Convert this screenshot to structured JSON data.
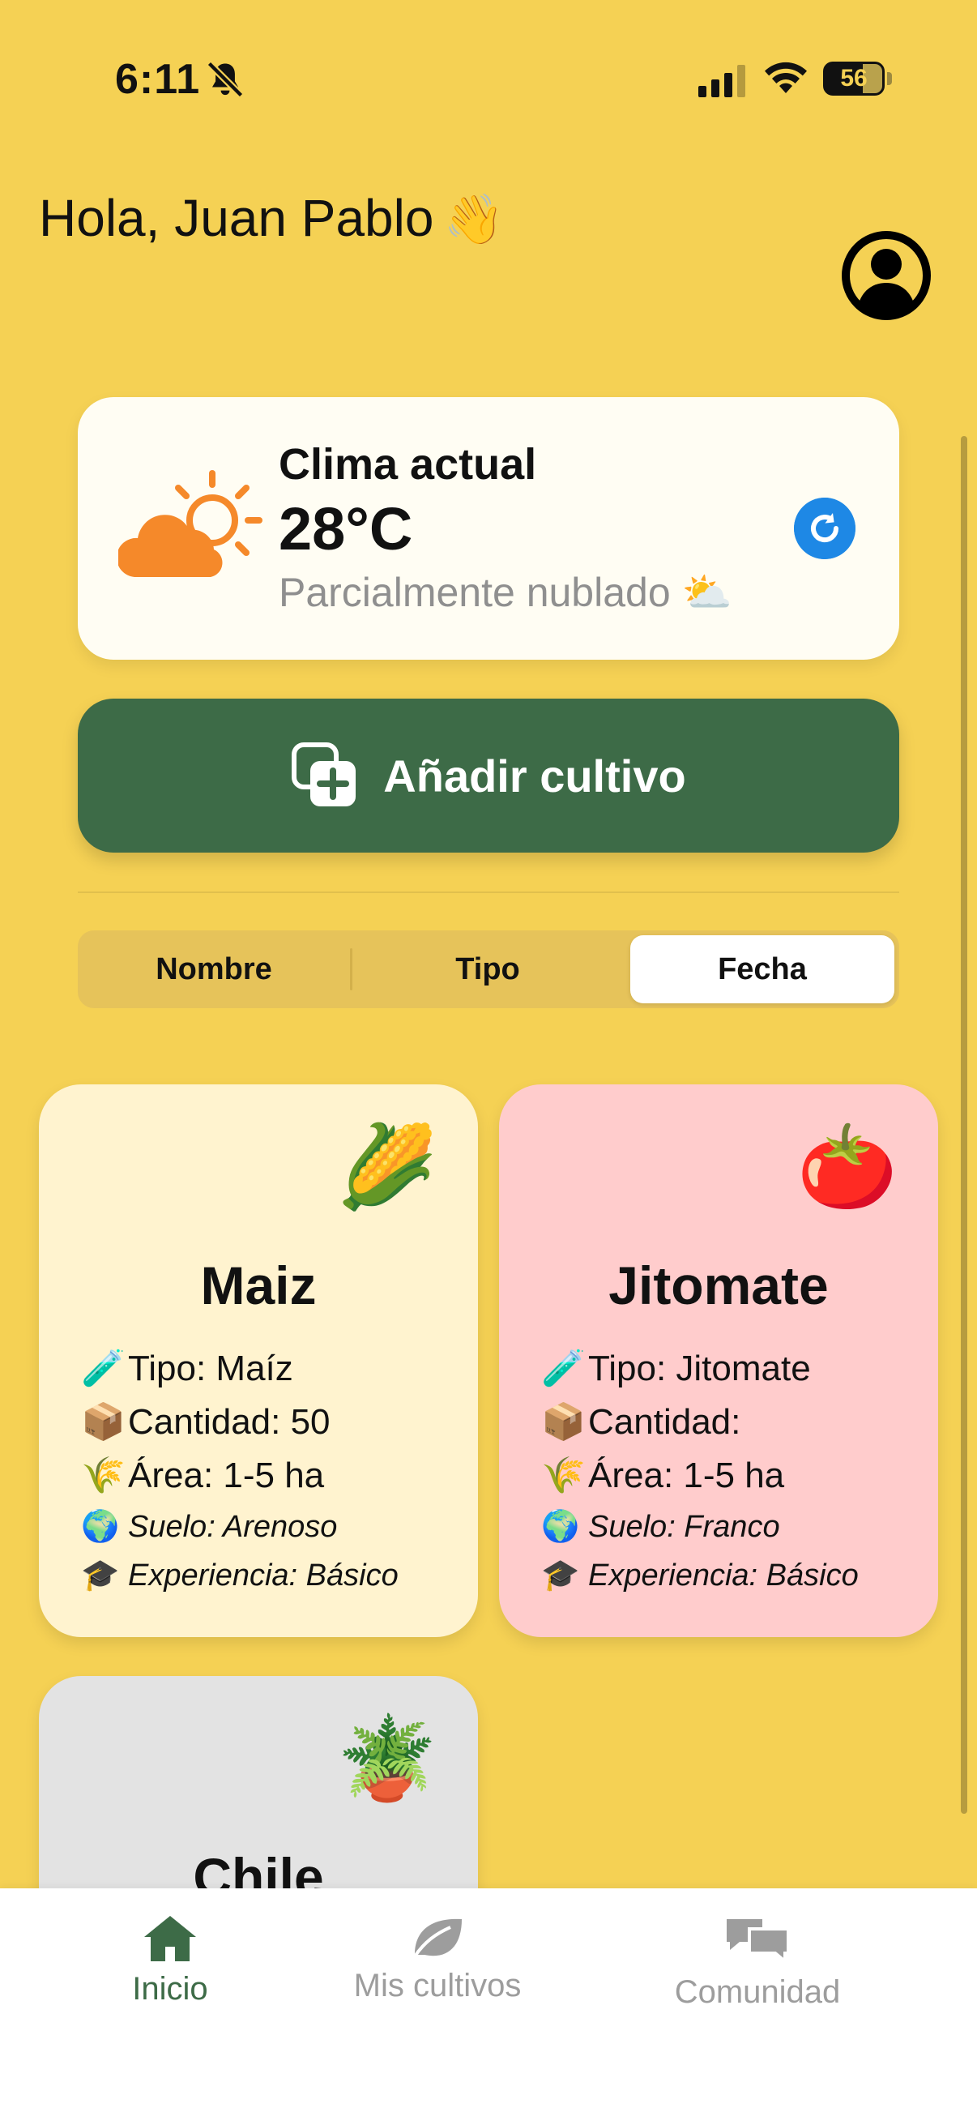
{
  "status_bar": {
    "time": "6:11",
    "battery": "56"
  },
  "header": {
    "greeting": "Hola, Juan Pablo",
    "wave_emoji": "👋"
  },
  "weather": {
    "title": "Clima actual",
    "temperature": "28°C",
    "description": "Parcialmente nublado ⛅"
  },
  "add_button": {
    "label": "Añadir cultivo"
  },
  "segments": {
    "items": [
      "Nombre",
      "Tipo",
      "Fecha"
    ],
    "selected": "Fecha"
  },
  "crops": [
    {
      "name": "Maiz",
      "emoji": "🌽",
      "color": "#FFF3CF",
      "tipo": "🧪",
      "tipo_text": "Tipo: Maíz",
      "cantidad": "📦",
      "cantidad_text": "Cantidad: 50",
      "area": "🌾",
      "area_text": "Área: 1-5 ha",
      "suelo": "🌍",
      "suelo_text": "Suelo: Arenoso",
      "exp": "🎓",
      "exp_text": "Experiencia: Básico"
    },
    {
      "name": "Jitomate",
      "emoji": "🍅",
      "color": "#FFCCCC",
      "tipo": "🧪",
      "tipo_text": "Tipo: Jitomate",
      "cantidad": "📦",
      "cantidad_text": "Cantidad:",
      "area": "🌾",
      "area_text": "Área: 1-5 ha",
      "suelo": "🌍",
      "suelo_text": "Suelo: Franco",
      "exp": "🎓",
      "exp_text": "Experiencia: Básico"
    },
    {
      "name": "Chile",
      "emoji": "🪴",
      "color": "#E3E3E3"
    }
  ],
  "tabbar": {
    "inicio": "Inicio",
    "mis_cultivos": "Mis cultivos",
    "comunidad": "Comunidad"
  },
  "colors": {
    "background": "#F5D154",
    "primary_green": "#3D6B47",
    "accent_blue": "#1E88E5"
  }
}
